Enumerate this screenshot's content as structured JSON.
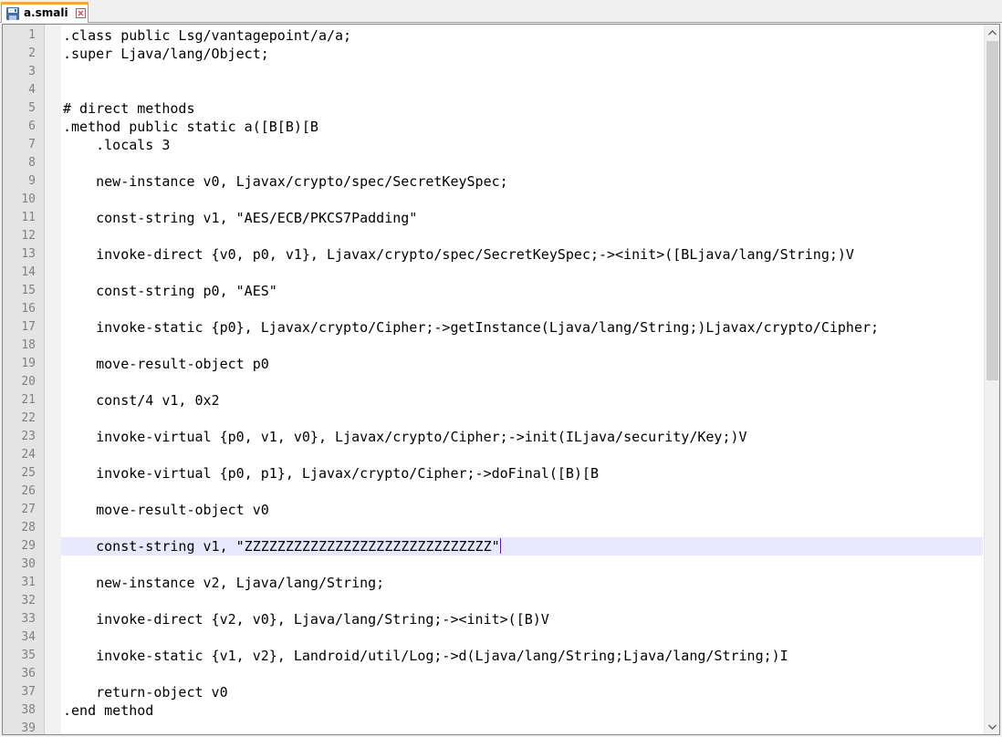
{
  "tab": {
    "label": "a.smali",
    "save_icon": "save-icon",
    "close_icon": "close-icon"
  },
  "editor": {
    "current_line": 29,
    "lines": [
      {
        "n": "1",
        "text": ".class public Lsg/vantagepoint/a/a;"
      },
      {
        "n": "2",
        "text": ".super Ljava/lang/Object;"
      },
      {
        "n": "3",
        "text": ""
      },
      {
        "n": "4",
        "text": ""
      },
      {
        "n": "5",
        "text": "# direct methods"
      },
      {
        "n": "6",
        "text": ".method public static a([B[B)[B"
      },
      {
        "n": "7",
        "text": "    .locals 3"
      },
      {
        "n": "8",
        "text": ""
      },
      {
        "n": "9",
        "text": "    new-instance v0, Ljavax/crypto/spec/SecretKeySpec;"
      },
      {
        "n": "10",
        "text": ""
      },
      {
        "n": "11",
        "text": "    const-string v1, \"AES/ECB/PKCS7Padding\""
      },
      {
        "n": "12",
        "text": ""
      },
      {
        "n": "13",
        "text": "    invoke-direct {v0, p0, v1}, Ljavax/crypto/spec/SecretKeySpec;-><init>([BLjava/lang/String;)V"
      },
      {
        "n": "14",
        "text": ""
      },
      {
        "n": "15",
        "text": "    const-string p0, \"AES\""
      },
      {
        "n": "16",
        "text": ""
      },
      {
        "n": "17",
        "text": "    invoke-static {p0}, Ljavax/crypto/Cipher;->getInstance(Ljava/lang/String;)Ljavax/crypto/Cipher;"
      },
      {
        "n": "18",
        "text": ""
      },
      {
        "n": "19",
        "text": "    move-result-object p0"
      },
      {
        "n": "20",
        "text": ""
      },
      {
        "n": "21",
        "text": "    const/4 v1, 0x2"
      },
      {
        "n": "22",
        "text": ""
      },
      {
        "n": "23",
        "text": "    invoke-virtual {p0, v1, v0}, Ljavax/crypto/Cipher;->init(ILjava/security/Key;)V"
      },
      {
        "n": "24",
        "text": ""
      },
      {
        "n": "25",
        "text": "    invoke-virtual {p0, p1}, Ljavax/crypto/Cipher;->doFinal([B)[B"
      },
      {
        "n": "26",
        "text": ""
      },
      {
        "n": "27",
        "text": "    move-result-object v0"
      },
      {
        "n": "28",
        "text": ""
      },
      {
        "n": "29",
        "text": "    const-string v1, \"ZZZZZZZZZZZZZZZZZZZZZZZZZZZZZZ\""
      },
      {
        "n": "30",
        "text": ""
      },
      {
        "n": "31",
        "text": "    new-instance v2, Ljava/lang/String;"
      },
      {
        "n": "32",
        "text": ""
      },
      {
        "n": "33",
        "text": "    invoke-direct {v2, v0}, Ljava/lang/String;-><init>([B)V"
      },
      {
        "n": "34",
        "text": ""
      },
      {
        "n": "35",
        "text": "    invoke-static {v1, v2}, Landroid/util/Log;->d(Ljava/lang/String;Ljava/lang/String;)I"
      },
      {
        "n": "36",
        "text": ""
      },
      {
        "n": "37",
        "text": "    return-object v0"
      },
      {
        "n": "38",
        "text": ".end method"
      },
      {
        "n": "39",
        "text": ""
      }
    ]
  },
  "scrollbar": {
    "up_icon": "arrow-up-icon",
    "down_icon": "arrow-down-icon"
  },
  "colors": {
    "tab_accent": "#f8a63c",
    "current_line_bg": "#e8e8ff",
    "caret": "#8000ff",
    "gutter_bg": "#e4e4e4",
    "line_number": "#808080"
  }
}
